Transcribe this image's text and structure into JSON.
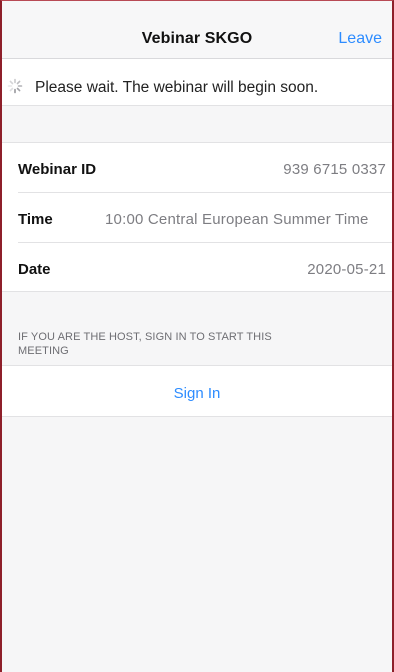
{
  "nav": {
    "title": "Vebinar SKGO",
    "leave_label": "Leave"
  },
  "status": {
    "message": "Please wait. The webinar will begin soon.",
    "icon": "loading-spinner-icon"
  },
  "details": [
    {
      "label": "Webinar ID",
      "value": "939 6715 0337"
    },
    {
      "label": "Time",
      "value": "10:00 Central European Summer Time"
    },
    {
      "label": "Date",
      "value": "2020-05-21"
    }
  ],
  "host_section": {
    "note": "IF YOU ARE THE HOST, SIGN IN TO START THIS MEETING",
    "sign_in_label": "Sign In"
  },
  "colors": {
    "accent": "#2d8cff",
    "frame_border": "#8e1f2a"
  }
}
